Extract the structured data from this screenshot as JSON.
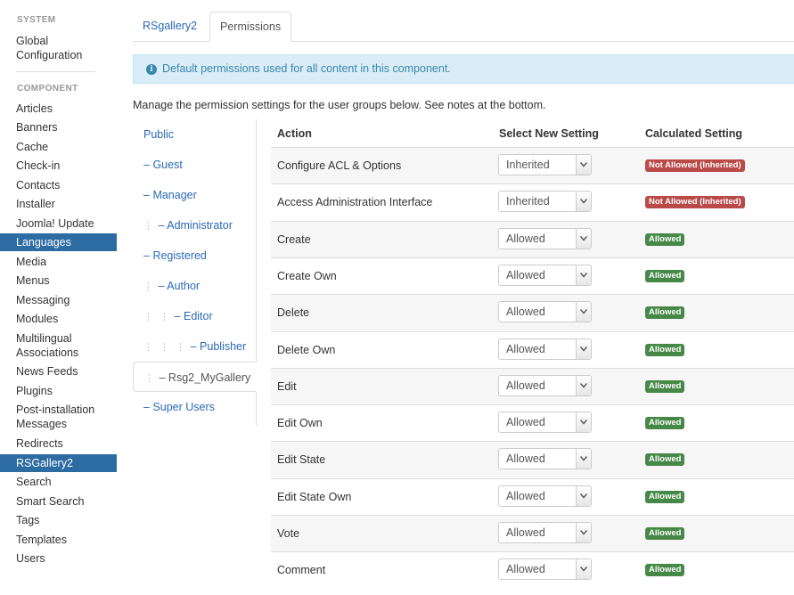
{
  "sidebar": {
    "system_heading": "SYSTEM",
    "global_config": "Global Configuration",
    "component_heading": "COMPONENT",
    "items": [
      {
        "label": "Articles",
        "active": false
      },
      {
        "label": "Banners",
        "active": false
      },
      {
        "label": "Cache",
        "active": false
      },
      {
        "label": "Check-in",
        "active": false
      },
      {
        "label": "Contacts",
        "active": false
      },
      {
        "label": "Installer",
        "active": false
      },
      {
        "label": "Joomla! Update",
        "active": false
      },
      {
        "label": "Languages",
        "active": true
      },
      {
        "label": "Media",
        "active": false
      },
      {
        "label": "Menus",
        "active": false
      },
      {
        "label": "Messaging",
        "active": false
      },
      {
        "label": "Modules",
        "active": false
      },
      {
        "label": "Multilingual Associations",
        "active": false
      },
      {
        "label": "News Feeds",
        "active": false
      },
      {
        "label": "Plugins",
        "active": false
      },
      {
        "label": "Post-installation Messages",
        "active": false
      },
      {
        "label": "Redirects",
        "active": false
      },
      {
        "label": "RSGallery2",
        "active": true
      },
      {
        "label": "Search",
        "active": false
      },
      {
        "label": "Smart Search",
        "active": false
      },
      {
        "label": "Tags",
        "active": false
      },
      {
        "label": "Templates",
        "active": false
      },
      {
        "label": "Users",
        "active": false
      }
    ]
  },
  "tabs": [
    {
      "label": "RSgallery2",
      "active": false
    },
    {
      "label": "Permissions",
      "active": true
    }
  ],
  "alert": {
    "icon": "info-icon",
    "text": "Default permissions used for all content in this component."
  },
  "intro": "Manage the permission settings for the user groups below. See notes at the bottom.",
  "groups": [
    {
      "label": "Public",
      "prefix": "",
      "dots": "",
      "active": false
    },
    {
      "label": "Guest",
      "prefix": "– ",
      "dots": "",
      "active": false
    },
    {
      "label": "Manager",
      "prefix": "– ",
      "dots": "",
      "active": false
    },
    {
      "label": "Administrator",
      "prefix": "– ",
      "dots": "⋮",
      "active": false
    },
    {
      "label": "Registered",
      "prefix": "– ",
      "dots": "",
      "active": false
    },
    {
      "label": "Author",
      "prefix": "– ",
      "dots": "⋮",
      "active": false
    },
    {
      "label": "Editor",
      "prefix": "– ",
      "dots": "⋮ ⋮",
      "active": false
    },
    {
      "label": "Publisher",
      "prefix": "– ",
      "dots": "⋮ ⋮ ⋮",
      "active": false
    },
    {
      "label": "Rsg2_MyGallery",
      "prefix": "– ",
      "dots": "⋮",
      "active": true
    },
    {
      "label": "Super Users",
      "prefix": "– ",
      "dots": "",
      "active": false
    }
  ],
  "table": {
    "headers": {
      "action": "Action",
      "select": "Select New Setting",
      "calc": "Calculated Setting"
    },
    "rows": [
      {
        "action": "Configure ACL & Options",
        "setting": "Inherited",
        "calculated": "Not Allowed (Inherited)",
        "status": "denied"
      },
      {
        "action": "Access Administration Interface",
        "setting": "Inherited",
        "calculated": "Not Allowed (Inherited)",
        "status": "denied"
      },
      {
        "action": "Create",
        "setting": "Allowed",
        "calculated": "Allowed",
        "status": "allowed"
      },
      {
        "action": "Create Own",
        "setting": "Allowed",
        "calculated": "Allowed",
        "status": "allowed"
      },
      {
        "action": "Delete",
        "setting": "Allowed",
        "calculated": "Allowed",
        "status": "allowed"
      },
      {
        "action": "Delete Own",
        "setting": "Allowed",
        "calculated": "Allowed",
        "status": "allowed"
      },
      {
        "action": "Edit",
        "setting": "Allowed",
        "calculated": "Allowed",
        "status": "allowed"
      },
      {
        "action": "Edit Own",
        "setting": "Allowed",
        "calculated": "Allowed",
        "status": "allowed"
      },
      {
        "action": "Edit State",
        "setting": "Allowed",
        "calculated": "Allowed",
        "status": "allowed"
      },
      {
        "action": "Edit State Own",
        "setting": "Allowed",
        "calculated": "Allowed",
        "status": "allowed"
      },
      {
        "action": "Vote",
        "setting": "Allowed",
        "calculated": "Allowed",
        "status": "allowed"
      },
      {
        "action": "Comment",
        "setting": "Allowed",
        "calculated": "Allowed",
        "status": "allowed"
      }
    ]
  },
  "colors": {
    "accent": "#2d6ca2",
    "link": "#2a69b8",
    "allowed": "#468847",
    "denied": "#b94a48",
    "info_bg": "#d9edf7"
  }
}
